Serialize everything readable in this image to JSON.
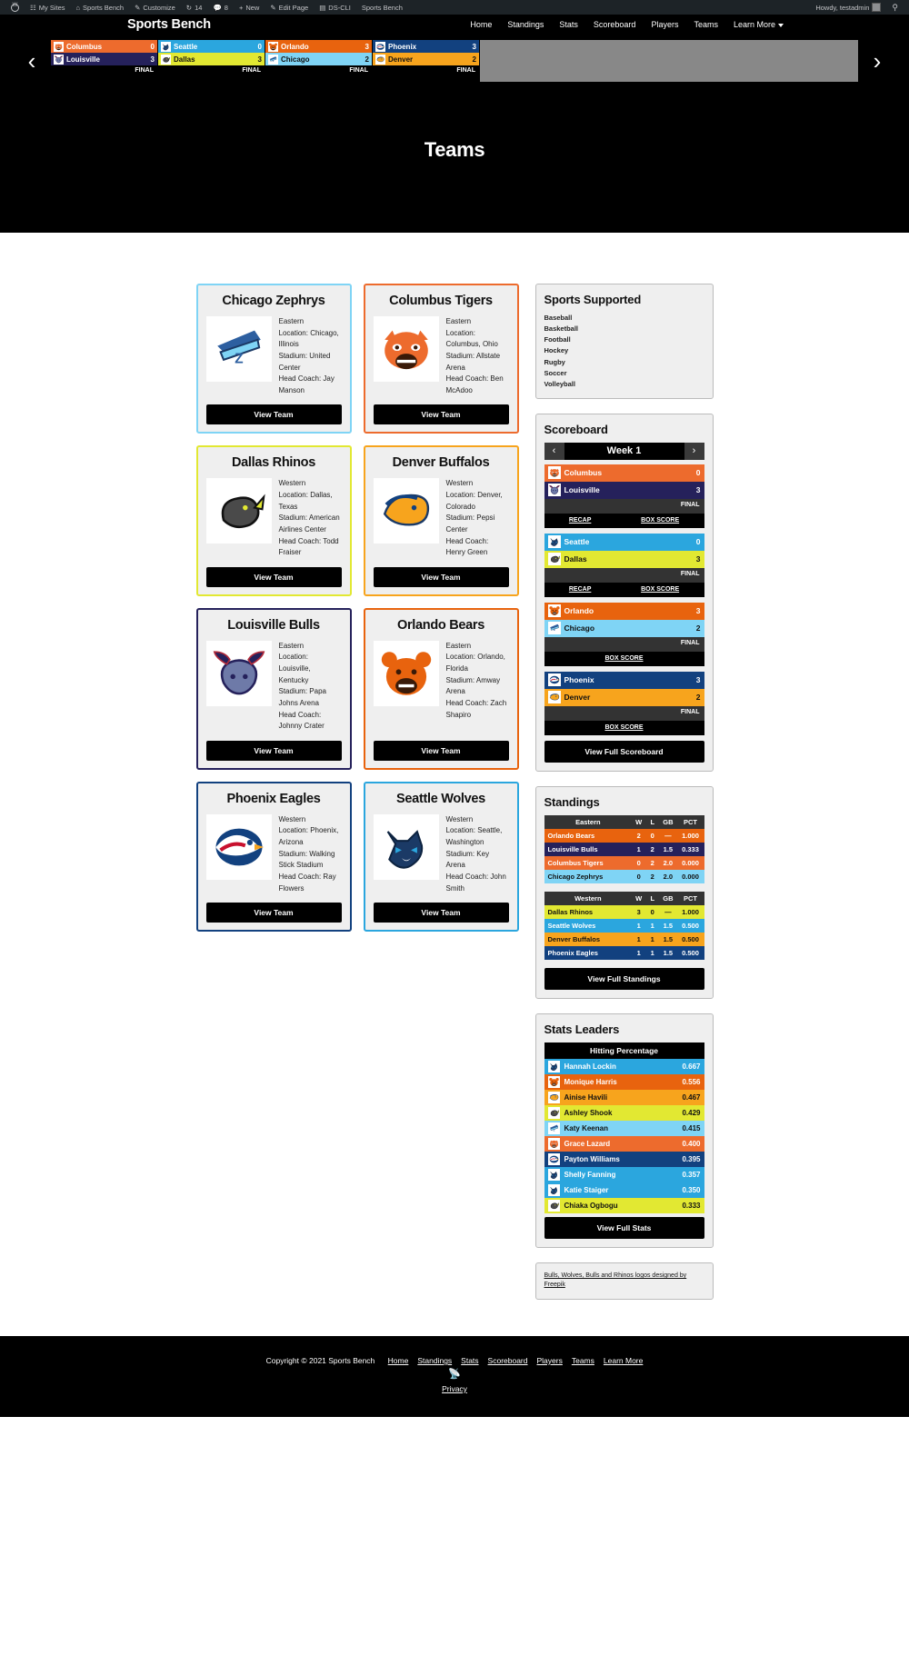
{
  "adminbar": {
    "items": [
      {
        "icon": "wordpress-logo-icon",
        "label": ""
      },
      {
        "icon": "my-sites-icon",
        "label": "My Sites"
      },
      {
        "icon": "site-icon",
        "label": "Sports Bench"
      },
      {
        "icon": "customize-icon",
        "label": "Customize"
      },
      {
        "icon": "updates-icon",
        "label": "14"
      },
      {
        "icon": "comments-icon",
        "label": "8"
      },
      {
        "icon": "plus-icon",
        "label": "New"
      },
      {
        "icon": "edit-icon",
        "label": "Edit Page"
      },
      {
        "icon": "dscli-icon",
        "label": "DS-CLI"
      },
      {
        "icon": "",
        "label": "Sports Bench"
      }
    ],
    "howdy": "Howdy, testadmin",
    "search_icon": "search-icon"
  },
  "header": {
    "brand": "Sports Bench",
    "nav": [
      {
        "label": "Home"
      },
      {
        "label": "Standings"
      },
      {
        "label": "Stats"
      },
      {
        "label": "Scoreboard"
      },
      {
        "label": "Players"
      },
      {
        "label": "Teams"
      },
      {
        "label": "Learn More",
        "has_caret": true
      }
    ]
  },
  "ticker": {
    "prev_icon": "chevron-left-icon",
    "next_icon": "chevron-right-icon",
    "games": [
      {
        "away": {
          "name": "Columbus",
          "score": "0",
          "bg": "#ED6B2D",
          "fg": "#ffffff",
          "logo": "tigers-logo-icon"
        },
        "home": {
          "name": "Louisville",
          "score": "3",
          "bg": "#25215B",
          "fg": "#ffffff",
          "logo": "bulls-logo-icon"
        },
        "status": "FINAL"
      },
      {
        "away": {
          "name": "Seattle",
          "score": "0",
          "bg": "#2BA6DE",
          "fg": "#ffffff",
          "logo": "wolves-logo-icon"
        },
        "home": {
          "name": "Dallas",
          "score": "3",
          "bg": "#E2E832",
          "fg": "#111111",
          "logo": "rhinos-logo-icon"
        },
        "status": "FINAL"
      },
      {
        "away": {
          "name": "Orlando",
          "score": "3",
          "bg": "#E8630E",
          "fg": "#ffffff",
          "logo": "bears-logo-icon"
        },
        "home": {
          "name": "Chicago",
          "score": "2",
          "bg": "#7FD4F5",
          "fg": "#111111",
          "logo": "zephyrs-logo-icon"
        },
        "status": "FINAL"
      },
      {
        "away": {
          "name": "Phoenix",
          "score": "3",
          "bg": "#12417F",
          "fg": "#ffffff",
          "logo": "eagles-logo-icon"
        },
        "home": {
          "name": "Denver",
          "score": "2",
          "bg": "#F7A41D",
          "fg": "#111111",
          "logo": "buffalos-logo-icon"
        },
        "status": "FINAL"
      }
    ]
  },
  "page": {
    "title": "Teams"
  },
  "teams": [
    {
      "name": "Chicago Zephrys",
      "logo": "zephyrs-logo-icon",
      "border": "#7FD4F5",
      "division": "Eastern",
      "location": "Location: Chicago, Illinois",
      "stadium": "Stadium: United Center",
      "coach": "Head Coach: Jay Manson",
      "button": "View Team"
    },
    {
      "name": "Columbus Tigers",
      "logo": "tigers-logo-icon",
      "border": "#ED6B2D",
      "division": "Eastern",
      "location": "Location: Columbus, Ohio",
      "stadium": "Stadium: Allstate Arena",
      "coach": "Head Coach: Ben McAdoo",
      "button": "View Team"
    },
    {
      "name": "Dallas Rhinos",
      "logo": "rhinos-logo-icon",
      "border": "#E2E832",
      "division": "Western",
      "location": "Location: Dallas, Texas",
      "stadium": "Stadium: American Airlines Center",
      "coach": "Head Coach: Todd Fraiser",
      "button": "View Team"
    },
    {
      "name": "Denver Buffalos",
      "logo": "buffalos-logo-icon",
      "border": "#F7A41D",
      "division": "Western",
      "location": "Location: Denver, Colorado",
      "stadium": "Stadium: Pepsi Center",
      "coach": "Head Coach: Henry Green",
      "button": "View Team"
    },
    {
      "name": "Louisville Bulls",
      "logo": "bulls-logo-icon",
      "border": "#25215B",
      "division": "Eastern",
      "location": "Location: Louisville, Kentucky",
      "stadium": "Stadium: Papa Johns Arena",
      "coach": "Head Coach: Johnny Crater",
      "button": "View Team"
    },
    {
      "name": "Orlando Bears",
      "logo": "bears-logo-icon",
      "border": "#E8630E",
      "division": "Eastern",
      "location": "Location: Orlando, Florida",
      "stadium": "Stadium: Amway Arena",
      "coach": "Head Coach: Zach Shapiro",
      "button": "View Team"
    },
    {
      "name": "Phoenix Eagles",
      "logo": "eagles-logo-icon",
      "border": "#12417F",
      "division": "Western",
      "location": "Location: Phoenix, Arizona",
      "stadium": "Stadium: Walking Stick Stadium",
      "coach": "Head Coach: Ray Flowers",
      "button": "View Team"
    },
    {
      "name": "Seattle Wolves",
      "logo": "wolves-logo-icon",
      "border": "#2BA6DE",
      "division": "Western",
      "location": "Location: Seattle, Washington",
      "stadium": "Stadium: Key Arena",
      "coach": "Head Coach: John Smith",
      "button": "View Team"
    }
  ],
  "sidebar": {
    "sports_supported": {
      "title": "Sports Supported",
      "items": [
        "Baseball",
        "Basketball",
        "Football",
        "Hockey",
        "Rugby",
        "Soccer",
        "Volleyball"
      ]
    },
    "scoreboard": {
      "title": "Scoreboard",
      "week_label": "Week 1",
      "prev_icon": "chevron-left-icon",
      "next_icon": "chevron-right-icon",
      "games": [
        {
          "away": {
            "name": "Columbus",
            "score": "0",
            "bg": "#ED6B2D",
            "fg": "#ffffff",
            "logo": "tigers-logo-icon"
          },
          "home": {
            "name": "Louisville",
            "score": "3",
            "bg": "#25215B",
            "fg": "#ffffff",
            "logo": "bulls-logo-icon"
          },
          "status": "FINAL",
          "links": [
            "RECAP",
            "BOX SCORE"
          ]
        },
        {
          "away": {
            "name": "Seattle",
            "score": "0",
            "bg": "#2BA6DE",
            "fg": "#ffffff",
            "logo": "wolves-logo-icon"
          },
          "home": {
            "name": "Dallas",
            "score": "3",
            "bg": "#E2E832",
            "fg": "#111111",
            "logo": "rhinos-logo-icon"
          },
          "status": "FINAL",
          "links": [
            "RECAP",
            "BOX SCORE"
          ]
        },
        {
          "away": {
            "name": "Orlando",
            "score": "3",
            "bg": "#E8630E",
            "fg": "#ffffff",
            "logo": "bears-logo-icon"
          },
          "home": {
            "name": "Chicago",
            "score": "2",
            "bg": "#7FD4F5",
            "fg": "#111111",
            "logo": "zephyrs-logo-icon"
          },
          "status": "FINAL",
          "links": [
            "BOX SCORE"
          ]
        },
        {
          "away": {
            "name": "Phoenix",
            "score": "3",
            "bg": "#12417F",
            "fg": "#ffffff",
            "logo": "eagles-logo-icon"
          },
          "home": {
            "name": "Denver",
            "score": "2",
            "bg": "#F7A41D",
            "fg": "#111111",
            "logo": "buffalos-logo-icon"
          },
          "status": "FINAL",
          "links": [
            "BOX SCORE"
          ]
        }
      ],
      "button": "View Full Scoreboard"
    },
    "standings": {
      "title": "Standings",
      "columns": [
        "W",
        "L",
        "GB",
        "PCT"
      ],
      "divisions": [
        {
          "name": "Eastern",
          "rows": [
            {
              "team": "Orlando Bears",
              "w": "2",
              "l": "0",
              "gb": "—",
              "pct": "1.000",
              "bg": "#E8630E",
              "fg": "#ffffff"
            },
            {
              "team": "Louisville Bulls",
              "w": "1",
              "l": "2",
              "gb": "1.5",
              "pct": "0.333",
              "bg": "#25215B",
              "fg": "#ffffff"
            },
            {
              "team": "Columbus Tigers",
              "w": "0",
              "l": "2",
              "gb": "2.0",
              "pct": "0.000",
              "bg": "#ED6B2D",
              "fg": "#ffffff"
            },
            {
              "team": "Chicago Zephrys",
              "w": "0",
              "l": "2",
              "gb": "2.0",
              "pct": "0.000",
              "bg": "#7FD4F5",
              "fg": "#111111"
            }
          ]
        },
        {
          "name": "Western",
          "rows": [
            {
              "team": "Dallas Rhinos",
              "w": "3",
              "l": "0",
              "gb": "—",
              "pct": "1.000",
              "bg": "#E2E832",
              "fg": "#111111"
            },
            {
              "team": "Seattle Wolves",
              "w": "1",
              "l": "1",
              "gb": "1.5",
              "pct": "0.500",
              "bg": "#2BA6DE",
              "fg": "#ffffff"
            },
            {
              "team": "Denver Buffalos",
              "w": "1",
              "l": "1",
              "gb": "1.5",
              "pct": "0.500",
              "bg": "#F7A41D",
              "fg": "#111111"
            },
            {
              "team": "Phoenix Eagles",
              "w": "1",
              "l": "1",
              "gb": "1.5",
              "pct": "0.500",
              "bg": "#12417F",
              "fg": "#ffffff"
            }
          ]
        }
      ],
      "button": "View Full Standings"
    },
    "stats_leaders": {
      "title": "Stats Leaders",
      "stat_name": "Hitting Percentage",
      "leaders": [
        {
          "player": "Hannah Lockin",
          "value": "0.667",
          "bg": "#2BA6DE",
          "fg": "#ffffff",
          "logo": "wolves-logo-icon"
        },
        {
          "player": "Monique Harris",
          "value": "0.556",
          "bg": "#E8630E",
          "fg": "#ffffff",
          "logo": "bears-logo-icon"
        },
        {
          "player": "Ainise Havili",
          "value": "0.467",
          "bg": "#F7A41D",
          "fg": "#111111",
          "logo": "buffalos-logo-icon"
        },
        {
          "player": "Ashley Shook",
          "value": "0.429",
          "bg": "#E2E832",
          "fg": "#111111",
          "logo": "rhinos-logo-icon"
        },
        {
          "player": "Katy Keenan",
          "value": "0.415",
          "bg": "#7FD4F5",
          "fg": "#111111",
          "logo": "zephyrs-logo-icon"
        },
        {
          "player": "Grace Lazard",
          "value": "0.400",
          "bg": "#ED6B2D",
          "fg": "#ffffff",
          "logo": "tigers-logo-icon"
        },
        {
          "player": "Payton Williams",
          "value": "0.395",
          "bg": "#12417F",
          "fg": "#ffffff",
          "logo": "eagles-logo-icon"
        },
        {
          "player": "Shelly Fanning",
          "value": "0.357",
          "bg": "#2BA6DE",
          "fg": "#ffffff",
          "logo": "wolves-logo-icon"
        },
        {
          "player": "Katie Staiger",
          "value": "0.350",
          "bg": "#2BA6DE",
          "fg": "#ffffff",
          "logo": "wolves-logo-icon"
        },
        {
          "player": "Chiaka Ogbogu",
          "value": "0.333",
          "bg": "#E2E832",
          "fg": "#111111",
          "logo": "rhinos-logo-icon"
        }
      ],
      "button": "View Full Stats"
    },
    "credits": "Bulls, Wolves, Bulls and Rhinos logos designed by Freepik"
  },
  "footer": {
    "copyright": "Copyright © 2021 Sports Bench",
    "nav": [
      "Home",
      "Standings",
      "Stats",
      "Scoreboard",
      "Players",
      "Teams",
      "Learn More"
    ],
    "rss_icon": "rss-icon",
    "privacy": "Privacy"
  }
}
